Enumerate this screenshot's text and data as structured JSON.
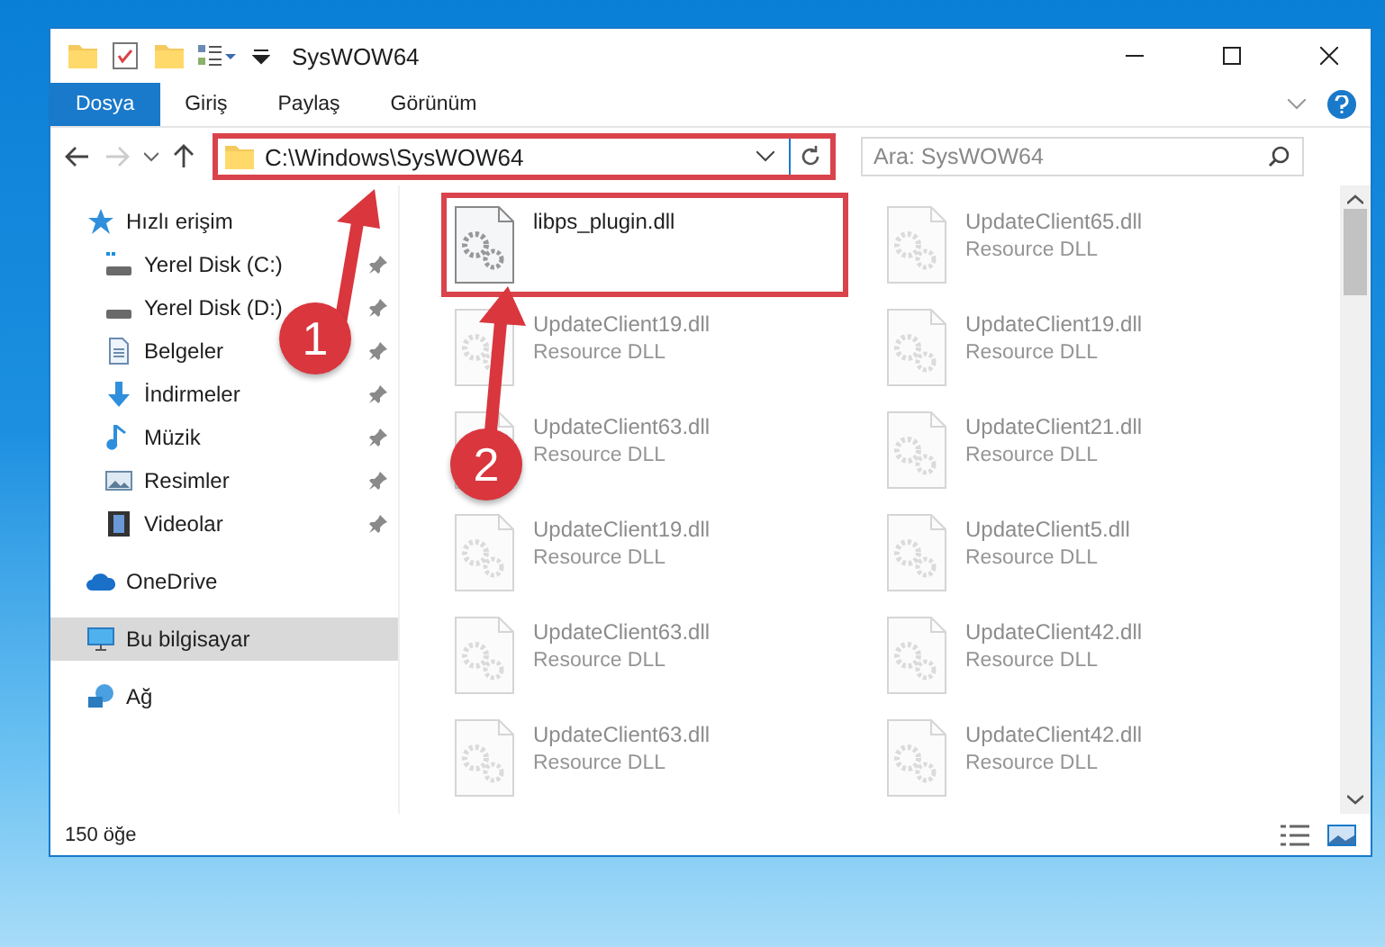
{
  "window": {
    "title": "SysWOW64"
  },
  "ribbon_tabs": [
    {
      "label": "Dosya",
      "selected": true
    },
    {
      "label": "Giriş",
      "selected": false
    },
    {
      "label": "Paylaş",
      "selected": false
    },
    {
      "label": "Görünüm",
      "selected": false
    }
  ],
  "address_bar": {
    "path": "C:\\Windows\\SysWOW64",
    "highlighted": true
  },
  "search": {
    "placeholder": "Ara: SysWOW64"
  },
  "sidebar": {
    "items": [
      {
        "label": "Hızlı erişim",
        "kind": "star",
        "pinned": false,
        "selected": false,
        "children": [
          {
            "label": "Yerel Disk (C:)",
            "kind": "drive-c",
            "pinned": true,
            "selected": false
          },
          {
            "label": "Yerel Disk (D:)",
            "kind": "drive",
            "pinned": true,
            "selected": false
          },
          {
            "label": "Belgeler",
            "kind": "document",
            "pinned": true,
            "selected": false
          },
          {
            "label": "İndirmeler",
            "kind": "download",
            "pinned": true,
            "selected": false
          },
          {
            "label": "Müzik",
            "kind": "music",
            "pinned": true,
            "selected": false
          },
          {
            "label": "Resimler",
            "kind": "picture",
            "pinned": true,
            "selected": false
          },
          {
            "label": "Videolar",
            "kind": "video",
            "pinned": true,
            "selected": false
          }
        ]
      },
      {
        "label": "OneDrive",
        "kind": "cloud",
        "pinned": false,
        "selected": false
      },
      {
        "label": "Bu bilgisayar",
        "kind": "computer",
        "pinned": false,
        "selected": true
      },
      {
        "label": "Ağ",
        "kind": "network",
        "pinned": false,
        "selected": false
      }
    ]
  },
  "files": [
    {
      "name": "libps_plugin.dll",
      "highlighted": true,
      "blurred": false
    },
    {
      "name": "UpdateClient65.dll",
      "type": "Resource DLL",
      "highlighted": false,
      "blurred": true
    },
    {
      "name": "UpdateClient19.dll",
      "type": "Resource DLL",
      "highlighted": false,
      "blurred": true
    },
    {
      "name": "UpdateClient19.dll",
      "type": "Resource DLL",
      "highlighted": false,
      "blurred": true
    },
    {
      "name": "UpdateClient63.dll",
      "type": "Resource DLL",
      "highlighted": false,
      "blurred": true
    },
    {
      "name": "UpdateClient21.dll",
      "type": "Resource DLL",
      "highlighted": false,
      "blurred": true
    },
    {
      "name": "UpdateClient19.dll",
      "type": "Resource DLL",
      "highlighted": false,
      "blurred": true
    },
    {
      "name": "UpdateClient5.dll",
      "type": "Resource DLL",
      "highlighted": false,
      "blurred": true
    },
    {
      "name": "UpdateClient63.dll",
      "type": "Resource DLL",
      "highlighted": false,
      "blurred": true
    },
    {
      "name": "UpdateClient42.dll",
      "type": "Resource DLL",
      "highlighted": false,
      "blurred": true
    },
    {
      "name": "UpdateClient63.dll",
      "type": "Resource DLL",
      "highlighted": false,
      "blurred": true
    },
    {
      "name": "UpdateClient42.dll",
      "type": "Resource DLL",
      "highlighted": false,
      "blurred": true
    }
  ],
  "status_bar": {
    "count": "150 öğe"
  },
  "annotations": [
    {
      "number": "1"
    },
    {
      "number": "2"
    }
  ]
}
